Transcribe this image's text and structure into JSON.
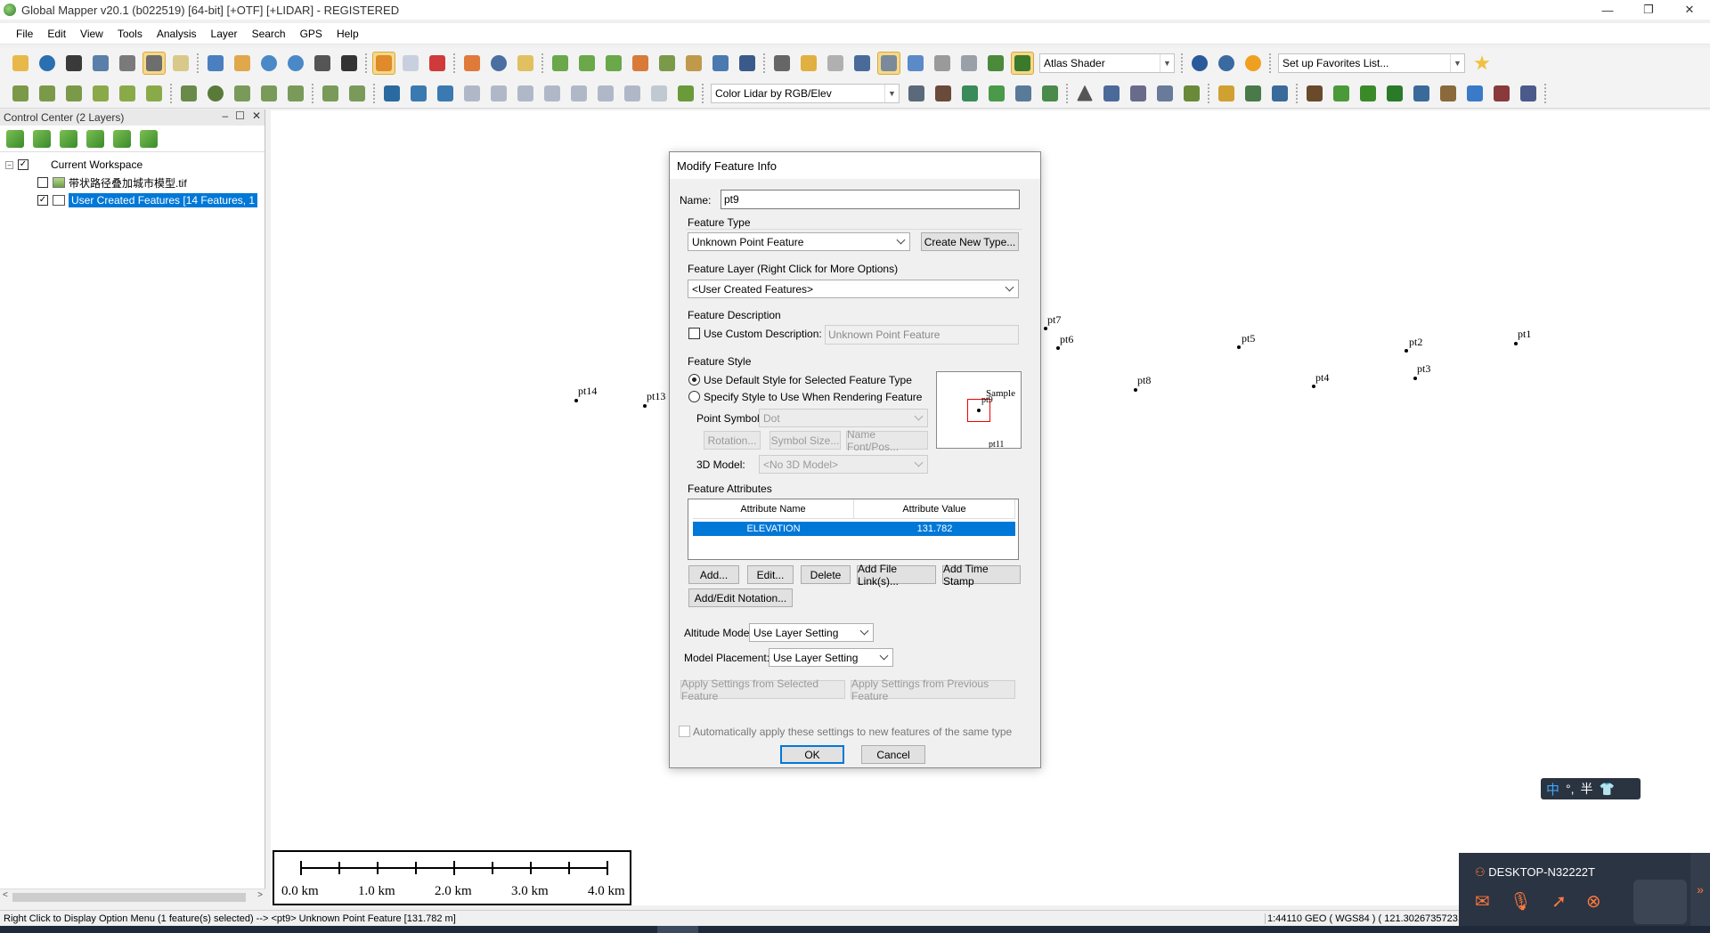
{
  "window": {
    "title": "Global Mapper v20.1 (b022519) [64-bit] [+OTF] [+LIDAR] - REGISTERED",
    "minimize": "—",
    "restore": "❐",
    "close": "✕"
  },
  "menu": [
    "File",
    "Edit",
    "View",
    "Tools",
    "Analysis",
    "Layer",
    "Search",
    "GPS",
    "Help"
  ],
  "toolbar": {
    "shader_combo": "Atlas Shader",
    "favorites_combo": "Set up Favorites List...",
    "lidar_combo": "Color Lidar by RGB/Elev"
  },
  "control_center": {
    "title": "Control Center (2 Layers)",
    "workspace": "Current Workspace",
    "layer1": "带状路径叠加城市模型.tif",
    "layer2": "User Created Features [14 Features, 1"
  },
  "map_points": [
    {
      "label": "pt7"
    },
    {
      "label": "pt6"
    },
    {
      "label": "pt5"
    },
    {
      "label": "pt2"
    },
    {
      "label": "pt1"
    },
    {
      "label": "pt8"
    },
    {
      "label": "pt4"
    },
    {
      "label": "pt3"
    },
    {
      "label": "pt14"
    },
    {
      "label": "pt13"
    }
  ],
  "scalebar": {
    "labels": [
      "0.0 km",
      "1.0 km",
      "2.0 km",
      "3.0 km",
      "4.0 km"
    ]
  },
  "dialog": {
    "title": "Modify Feature Info",
    "name_label": "Name:",
    "name_value": "pt9",
    "feature_type_group": "Feature Type",
    "feature_type_value": "Unknown Point Feature",
    "create_new_type": "Create New Type...",
    "feature_layer_group": "Feature Layer (Right Click for More Options)",
    "feature_layer_value": "<User Created Features>",
    "feature_description_group": "Feature Description",
    "use_custom_description": "Use Custom Description:",
    "custom_description_value": "Unknown Point Feature",
    "feature_style_group": "Feature Style",
    "radio_default_style": "Use Default Style for Selected Feature Type",
    "radio_specify_style": "Specify Style to Use When Rendering Feature",
    "point_symbol_label": "Point Symbol",
    "point_symbol_value": "Dot",
    "rotation_btn": "Rotation...",
    "symbol_size_btn": "Symbol Size...",
    "name_font_btn": "Name Font/Pos...",
    "model_3d_label": "3D Model:",
    "model_3d_value": "<No 3D Model>",
    "preview_sample": "Sample",
    "preview_pt9": "pt9",
    "preview_pt11": "pt11",
    "feature_attributes_group": "Feature Attributes",
    "attr_col_name": "Attribute Name",
    "attr_col_value": "Attribute Value",
    "attributes": [
      {
        "name": "ELEVATION",
        "value": "131.782"
      }
    ],
    "add_btn": "Add...",
    "edit_btn": "Edit...",
    "delete_btn": "Delete",
    "add_file_links_btn": "Add File Link(s)...",
    "add_time_stamp_btn": "Add Time Stamp",
    "add_edit_notation_btn": "Add/Edit Notation...",
    "altitude_mode_label": "Altitude Mode:",
    "altitude_mode_value": "Use Layer Setting",
    "model_placement_label": "Model Placement:",
    "model_placement_value": "Use Layer Setting",
    "apply_selected_btn": "Apply Settings from Selected Feature",
    "apply_previous_btn": "Apply Settings from Previous Feature",
    "auto_apply_label": "Automatically apply these settings to new features of the same type",
    "ok_btn": "OK",
    "cancel_btn": "Cancel"
  },
  "statusbar": {
    "message": "Right Click to Display Option Menu (1 feature(s) selected) --> <pt9> Unknown Point Feature [131.782 m]",
    "coords": "1:44110  GEO ( WGS84 ) ( 121.3026735723,"
  },
  "ime": {
    "mode": "中",
    "punct": "°,",
    "width": "半"
  },
  "remote": {
    "computer_name": "DESKTOP-N32222T"
  }
}
